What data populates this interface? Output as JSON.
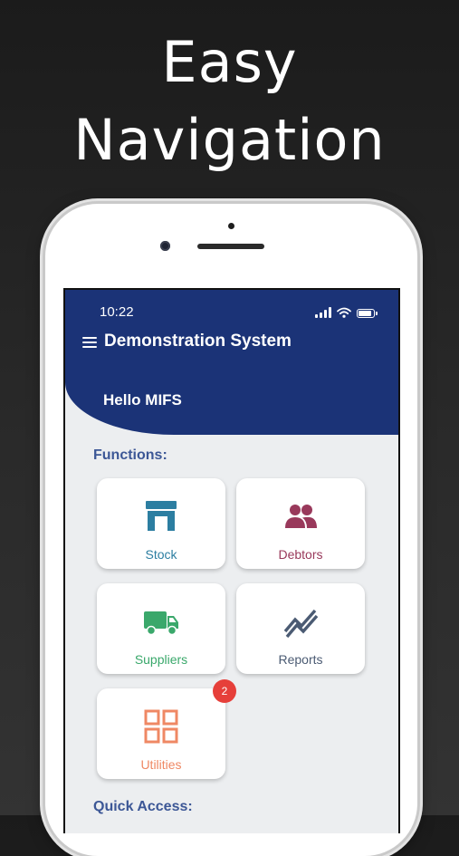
{
  "promo": {
    "line1": "Easy",
    "line2": "Navigation"
  },
  "status_bar": {
    "time": "10:22"
  },
  "app_bar": {
    "title": "Demonstration System",
    "greeting": "Hello MIFS"
  },
  "functions": {
    "label": "Functions:",
    "cards": [
      {
        "label": "Stock",
        "icon": "store-icon",
        "color": "#2c7ea1"
      },
      {
        "label": "Debtors",
        "icon": "people-icon",
        "color": "#99395b"
      },
      {
        "label": "Suppliers",
        "icon": "truck-icon",
        "color": "#3aa86b"
      },
      {
        "label": "Reports",
        "icon": "trend-chart-icon",
        "color": "#4b5b73"
      },
      {
        "label": "Utilities",
        "icon": "grid-icon",
        "color": "#ef8864",
        "badge": "2"
      }
    ]
  },
  "quick_access": {
    "label": "Quick Access:"
  },
  "colors": {
    "app_bar": "#1b3377",
    "background": "#eceef0",
    "section_label": "#3c5796",
    "badge": "#e63f3a"
  }
}
